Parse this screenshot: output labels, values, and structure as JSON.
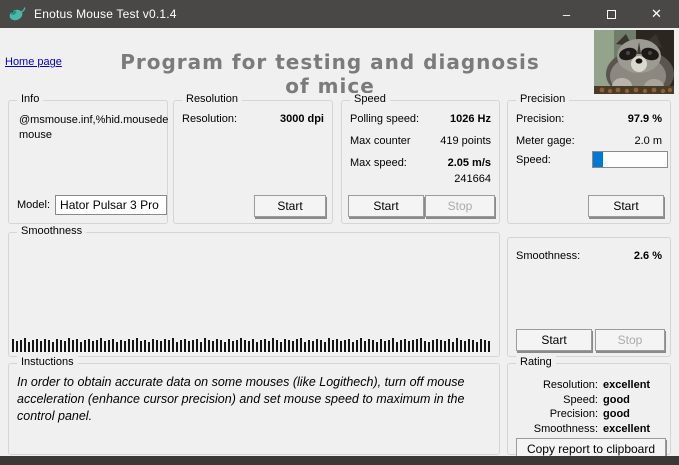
{
  "colors": {
    "accent": "#0078d7",
    "titlebar": "#4a4846",
    "link": "#0000cc",
    "heading": "#7b7b7b"
  },
  "title_bar": {
    "title": "Enotus Mouse Test v0.1.4",
    "minimize_glyph": "–",
    "close_glyph": "✕"
  },
  "header": {
    "home_link": "Home page",
    "heading": "Program for testing and diagnosis of mice"
  },
  "info": {
    "legend": "Info",
    "device_line1": "@msmouse.inf,%hid.mousede",
    "device_line2": "mouse",
    "model_label": "Model:",
    "model_value": "Hator Pulsar 3 Pro"
  },
  "resolution": {
    "legend": "Resolution",
    "label": "Resolution:",
    "value": "3000 dpi",
    "start_label": "Start"
  },
  "speed": {
    "legend": "Speed",
    "rows": [
      {
        "label": "Polling speed:",
        "value": "1026 Hz",
        "bold": true
      },
      {
        "label": "Max counter",
        "value": "419 points",
        "bold": false
      },
      {
        "label": "Max  speed:",
        "value": "2.05 m/s",
        "bold": true
      }
    ],
    "counter": "241664",
    "start_label": "Start",
    "stop_label": "Stop"
  },
  "precision": {
    "legend": "Precision",
    "rows": [
      {
        "label": "Precision:",
        "value": "97.9 %",
        "bold": true
      },
      {
        "label": "Meter gage:",
        "value": "2.0 m",
        "bold": false
      }
    ],
    "speed_label": "Speed:",
    "progress_percent": 13,
    "start_label": "Start"
  },
  "smoothness": {
    "legend": "Smoothness",
    "panel_label": "Smoothness:",
    "panel_value": "2.6 %",
    "start_label": "Start",
    "stop_label": "Stop",
    "histogram_heights": [
      13,
      11,
      12,
      14,
      10,
      12,
      13,
      11,
      13,
      12,
      10,
      13,
      12,
      11,
      14,
      12,
      13,
      10,
      12,
      13,
      11,
      12,
      14,
      11,
      12,
      13,
      10,
      12,
      11,
      13,
      12,
      14,
      11,
      12,
      10,
      13,
      12,
      11,
      13,
      12,
      14,
      10,
      12,
      13,
      11,
      12,
      13,
      10,
      14,
      12,
      11,
      13,
      12,
      10,
      13,
      11,
      12,
      14,
      12,
      11,
      13,
      10,
      12,
      13,
      11,
      14,
      12,
      10,
      13,
      12,
      11,
      13,
      14,
      10,
      12,
      11,
      13,
      12,
      10,
      14,
      12,
      13,
      11,
      12,
      13,
      10,
      12,
      14,
      11,
      13,
      12,
      10,
      13,
      11,
      12,
      14,
      10,
      12,
      13,
      11,
      12,
      13,
      14,
      11,
      10,
      12,
      13,
      12,
      11,
      13,
      10,
      14,
      12,
      11,
      13,
      12,
      10,
      13,
      12,
      11
    ]
  },
  "instructions": {
    "legend": "Instuctions",
    "text": "In order to obtain accurate data on some mouses (like Logithech), turn off mouse acceleration (enhance cursor precision) and set mouse speed to maximum in the control panel."
  },
  "rating": {
    "legend": "Rating",
    "rows": [
      {
        "label": "Resolution:",
        "value": "excellent"
      },
      {
        "label": "Speed:",
        "value": "good"
      },
      {
        "label": "Precision:",
        "value": "good"
      },
      {
        "label": "Smoothness:",
        "value": "excellent"
      }
    ],
    "copy_button": "Copy report to clipboard"
  }
}
